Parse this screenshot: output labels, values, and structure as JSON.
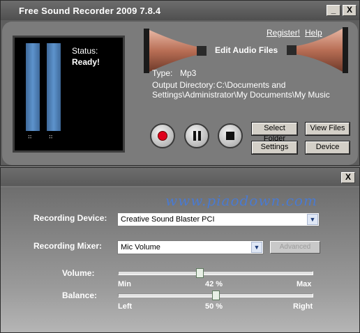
{
  "window": {
    "title": "Free Sound Recorder 2009 7.8.4",
    "minimize_label": "_",
    "close_label": "X"
  },
  "meter": {
    "status_label": "Status:",
    "status_value": "Ready!",
    "channel_dots": "∷"
  },
  "links": {
    "register": "Register!",
    "help": "Help"
  },
  "edit_audio_label": "Edit Audio Files",
  "info": {
    "type_label": "Type:",
    "type_value": "Mp3",
    "output_label": "Output Directory:",
    "output_line1": "C:\\Documents and",
    "output_line2": "Settings\\Administrator\\My Documents\\My Music"
  },
  "buttons": {
    "select_folder": "Select Folder",
    "view_files": "View Files",
    "settings": "Settings",
    "device": "Device"
  },
  "mixer_panel": {
    "close_label": "X",
    "watermark": "www.piaodown.com",
    "recording_device_label": "Recording Device:",
    "recording_device_value": "Creative Sound Blaster PCI",
    "recording_mixer_label": "Recording Mixer:",
    "recording_mixer_value": "Mic Volume",
    "advanced_label": "Advanced",
    "volume_label": "Volume:",
    "volume_min": "Min",
    "volume_value": "42 %",
    "volume_max": "Max",
    "volume_level": 0.42,
    "balance_label": "Balance:",
    "balance_left": "Left",
    "balance_value": "50 %",
    "balance_right": "Right",
    "balance_level": 0.5
  },
  "colors": {
    "accent_blue": "#5d93cc",
    "record_red": "#e0001c",
    "horn_copper": "#c98a72",
    "watermark_blue": "#4a7ad0"
  }
}
